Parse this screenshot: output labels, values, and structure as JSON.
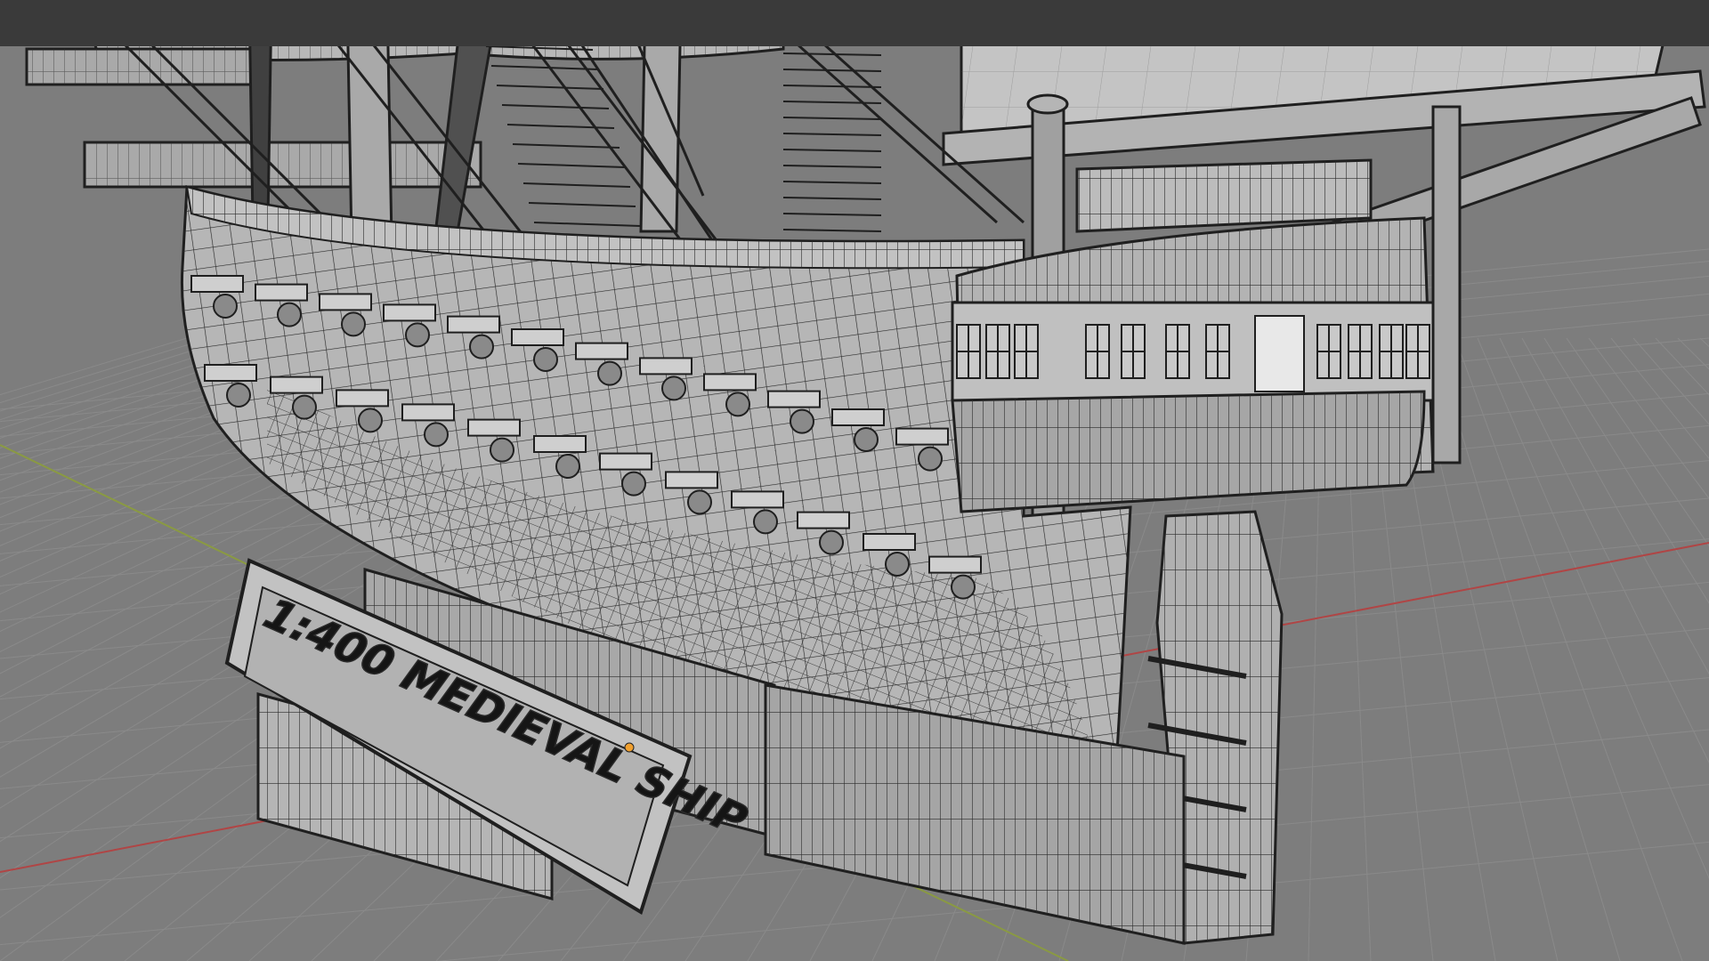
{
  "app": {
    "name": "3D viewport",
    "mode": "wireframe"
  },
  "scene": {
    "nameplate_text": "1:400 MEDIEVAL SHIP"
  },
  "colors": {
    "background": "#7d7d7d",
    "grid": "#8a8a8a",
    "x_axis": "#b04545",
    "y_axis": "#8a9a42",
    "hull_fill": "#b8b8b8",
    "wire": "#1f1f1f",
    "origin_marker": "#f0a030",
    "top_strip": "#3a3a3a"
  },
  "icons": {
    "origin": "origin-marker-icon"
  }
}
